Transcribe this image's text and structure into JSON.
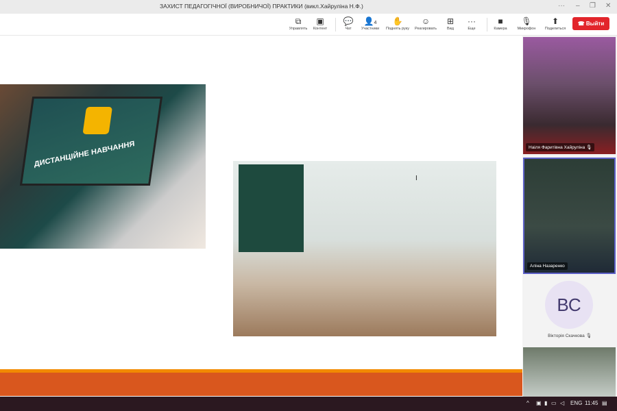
{
  "window": {
    "title": "ЗАХИСТ ПЕДАГОГІЧНОЇ (ВИРОБНИЧОЇ) ПРАКТИКИ (викл.Хайрулiна Н.Ф.)",
    "more": "···",
    "minimize": "–",
    "restore": "❐",
    "close": "✕"
  },
  "toolbar": {
    "control": {
      "icon": "⧉",
      "label": "Управлять"
    },
    "content": {
      "icon": "▣",
      "label": "Контент"
    },
    "chat": {
      "icon": "💬",
      "label": "Чат"
    },
    "participants": {
      "icon": "👤",
      "label": "Участники",
      "count": "4"
    },
    "raise_hand": {
      "icon": "✋",
      "label": "Поднять руку"
    },
    "react": {
      "icon": "☺",
      "label": "Реагировать"
    },
    "view": {
      "icon": "⊞",
      "label": "Вид"
    },
    "more": {
      "icon": "···",
      "label": "Еще"
    },
    "camera": {
      "icon": "■",
      "label": "Камера"
    },
    "mic": {
      "icon": "🎙",
      "label": "Микрофон"
    },
    "share": {
      "icon": "⬆",
      "label": "Поделиться"
    },
    "leave": {
      "label": "Выйти"
    }
  },
  "slide": {
    "screen_text": "ДИСТАНЦІЙНЕ НАВЧАННЯ",
    "cursor": "I"
  },
  "participants": [
    {
      "name": "Наiля Фаритiвна Хайрулiна",
      "muted_icon": "🎙"
    },
    {
      "name": "Аліна Назаренко"
    },
    {
      "name": "Вікторія Скачкова",
      "initials": "ВС",
      "muted_icon": "🎙"
    },
    {
      "name": ""
    }
  ],
  "taskbar": {
    "lang": "ENG",
    "time": "11:45"
  }
}
